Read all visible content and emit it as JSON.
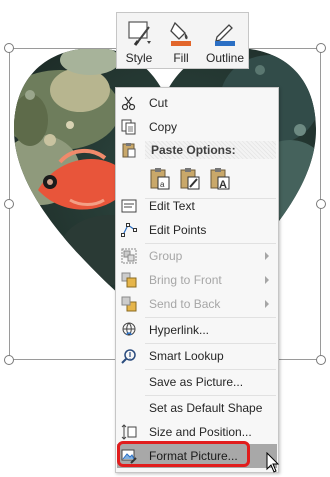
{
  "mini_toolbar": {
    "style_label": "Style",
    "fill_label": "Fill",
    "outline_label": "Outline",
    "fill_color": "#e2662b",
    "outline_color": "#2b6fc4"
  },
  "context_menu": {
    "cut": "Cut",
    "copy": "Copy",
    "paste_options": "Paste Options:",
    "edit_text": "Edit Text",
    "edit_points": "Edit Points",
    "group": "Group",
    "bring_to_front": "Bring to Front",
    "send_to_back": "Send to Back",
    "hyperlink": "Hyperlink...",
    "smart_lookup": "Smart Lookup",
    "save_as_picture": "Save as Picture...",
    "set_default_shape": "Set as Default Shape",
    "size_and_position": "Size and Position...",
    "format_picture": "Format Picture..."
  },
  "colors": {
    "highlight": "#e11d1d",
    "menu_hover": "#a8a8a8",
    "fish": "#e8553a"
  }
}
